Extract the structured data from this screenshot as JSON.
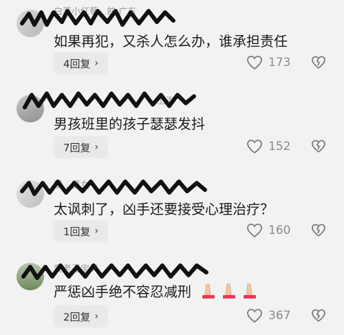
{
  "comments": [
    {
      "username": "白若小红莓",
      "meta": "前 广东",
      "text": "如果再犯，又杀人怎么办，谁承担责任",
      "reply_label": "4回复",
      "likes": "173"
    },
    {
      "username": "",
      "meta": "上海",
      "text": "男孩班里的孩子瑟瑟发抖",
      "reply_label": "7回复",
      "likes": "152"
    },
    {
      "username": "爱…莫女",
      "meta": "",
      "text": "太讽刺了，凶手还要接受心理治疗？",
      "reply_label": "1回复",
      "likes": "160"
    },
    {
      "username": "爱老王宝贝",
      "meta": "",
      "text": "严惩凶手绝不容忍减刑",
      "reply_label": "2回复",
      "likes": "367"
    }
  ],
  "icons": {
    "reply_chevron": "›",
    "like": "heart-outline-icon",
    "dislike": "broken-heart-icon",
    "praying_hands": "praying-hands-emoji"
  },
  "colors": {
    "background": "#f2f2f2",
    "reply_button": "#e9e9e9",
    "muted_text": "#9b9b9b"
  }
}
